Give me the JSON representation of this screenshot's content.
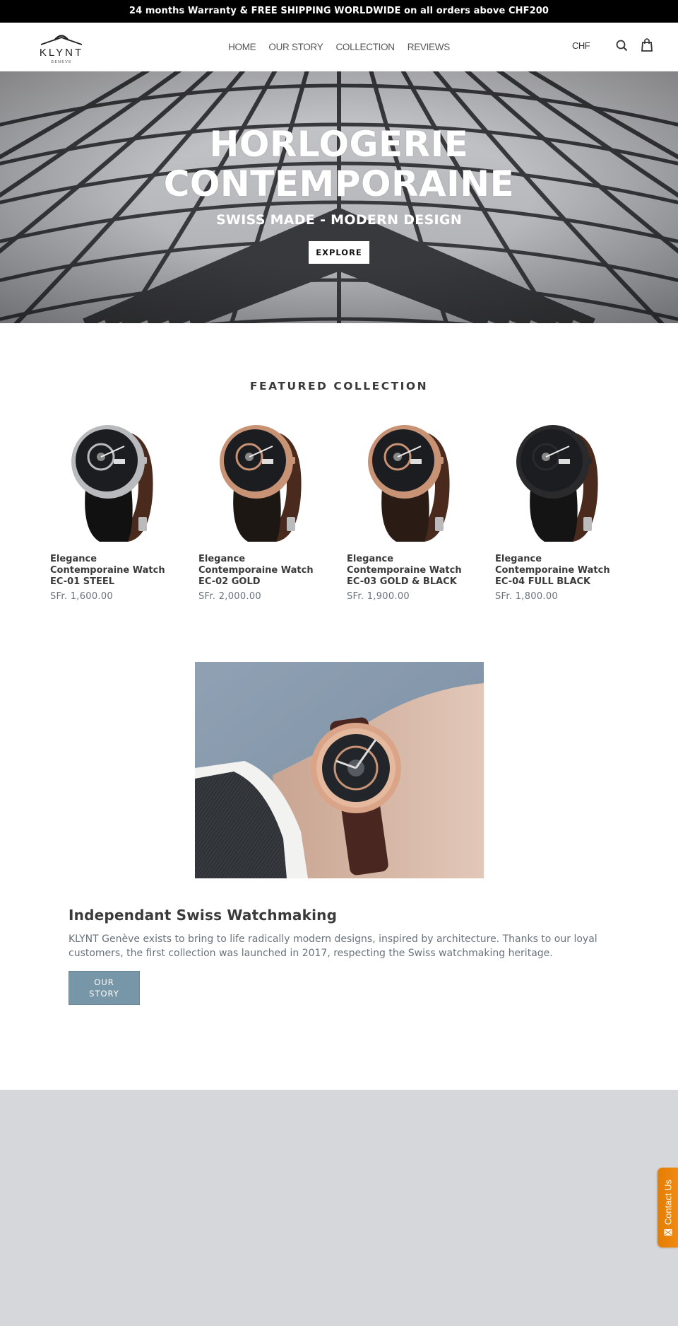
{
  "announcement": "24 months Warranty & FREE SHIPPING WORLDWIDE on all orders above CHF200",
  "header": {
    "logo": {
      "brand": "KLYNT",
      "tagline": "GENEVE"
    },
    "nav": [
      {
        "label": "HOME"
      },
      {
        "label": "OUR STORY"
      },
      {
        "label": "COLLECTION"
      },
      {
        "label": "REVIEWS"
      }
    ],
    "currency": "CHF",
    "icons": {
      "search": "search-icon",
      "cart": "shopping-bag-icon"
    }
  },
  "hero": {
    "title_line1": "HORLOGERIE",
    "title_line2": "CONTEMPORAINE",
    "subtitle": "SWISS MADE - MODERN DESIGN",
    "button": "EXPLORE"
  },
  "featured": {
    "title": "FEATURED COLLECTION",
    "products": [
      {
        "title": "Elegance Contemporaine Watch EC-01 STEEL",
        "price": "SFr. 1,600.00",
        "case_color": "#b8babd",
        "strap_color": "#111111"
      },
      {
        "title": "Elegance Contemporaine Watch EC-02 GOLD",
        "price": "SFr. 2,000.00",
        "case_color": "#c89275",
        "strap_color": "#1d1714"
      },
      {
        "title": "Elegance Contemporaine Watch EC-03 GOLD & BLACK",
        "price": "SFr. 1,900.00",
        "case_color": "#c89275",
        "strap_color": "#2a1c15"
      },
      {
        "title": "Elegance Contemporaine Watch EC-04 FULL BLACK",
        "price": "SFr. 1,800.00",
        "case_color": "#2a2a2c",
        "strap_color": "#141414"
      }
    ]
  },
  "story": {
    "title": "Independant Swiss Watchmaking",
    "text": "KLYNT Genève exists to bring to life radically modern designs, inspired by architecture. Thanks to our loyal customers, the first collection was launched in 2017, respecting the Swiss watchmaking heritage.",
    "button_line1": "OUR",
    "button_line2": "STORY"
  },
  "contact_tab": {
    "label": "Contact Us"
  },
  "colors": {
    "accent_button": "#7796a8",
    "contact_tab": "#e37d04",
    "footer_bg": "#d6d7db",
    "price": "#69727b"
  }
}
